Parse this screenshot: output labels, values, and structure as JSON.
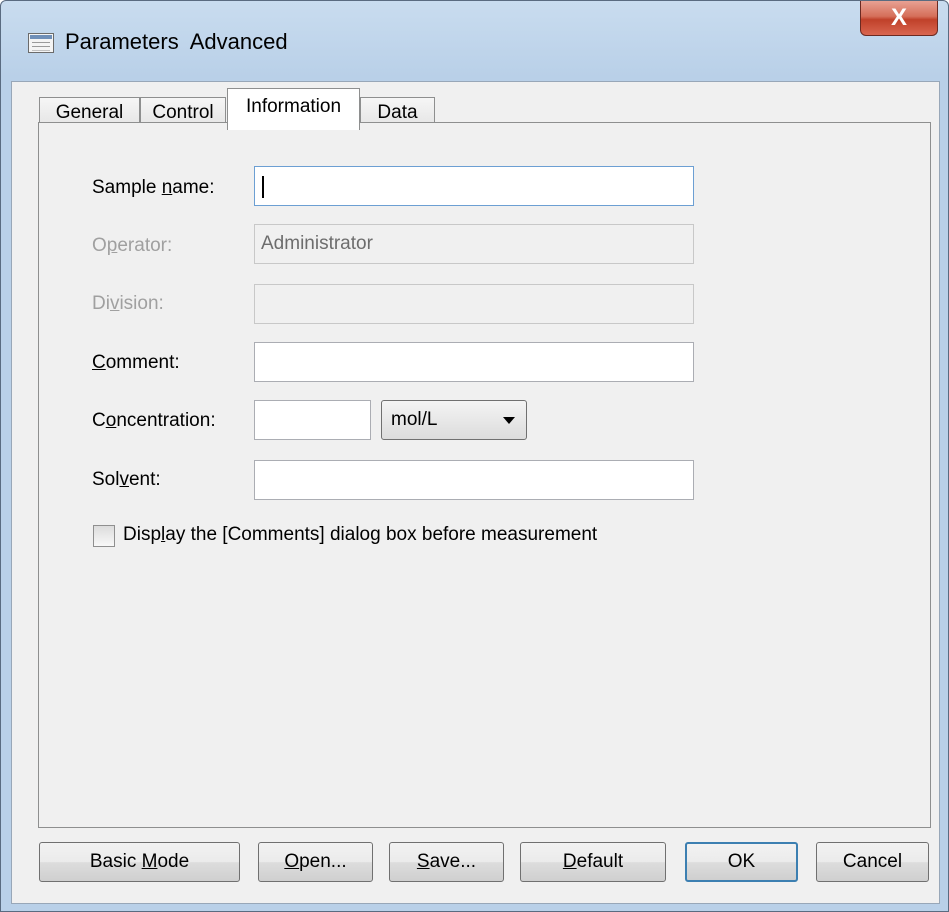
{
  "window": {
    "title": "Parameters  Advanced",
    "close_label": "X"
  },
  "tabs": [
    {
      "label": "General"
    },
    {
      "label": "Control"
    },
    {
      "label": "Information",
      "active": true
    },
    {
      "label": "Data"
    }
  ],
  "form": {
    "sample_name": {
      "pre": "Sample ",
      "key": "n",
      "post": "ame:",
      "value": ""
    },
    "operator": {
      "pre": "O",
      "key": "p",
      "post": "erator:",
      "value": "Administrator"
    },
    "division": {
      "pre": "Di",
      "key": "v",
      "post": "ision:",
      "value": ""
    },
    "comment": {
      "pre": "",
      "key": "C",
      "post": "omment:",
      "value": ""
    },
    "concentration": {
      "pre": "C",
      "key": "o",
      "post": "ncentration:",
      "value": "",
      "unit": "mol/L"
    },
    "solvent": {
      "pre": "Sol",
      "key": "v",
      "post": "ent:",
      "value": ""
    },
    "checkbox": {
      "pre": "Disp",
      "key": "l",
      "post": "ay the [Comments] dialog box before measurement",
      "checked": false
    }
  },
  "buttons": {
    "basic_mode": {
      "pre": "Basic ",
      "key": "M",
      "post": "ode"
    },
    "open": {
      "pre": "",
      "key": "O",
      "post": "pen..."
    },
    "save": {
      "pre": "",
      "key": "S",
      "post": "ave..."
    },
    "default": {
      "pre": "",
      "key": "D",
      "post": "efault"
    },
    "ok": {
      "label": "OK"
    },
    "cancel": {
      "label": "Cancel"
    }
  },
  "colors": {
    "close_button": "#c9462f",
    "title_bar": "#b9d0e8",
    "focus_border": "#6c9fd3"
  }
}
